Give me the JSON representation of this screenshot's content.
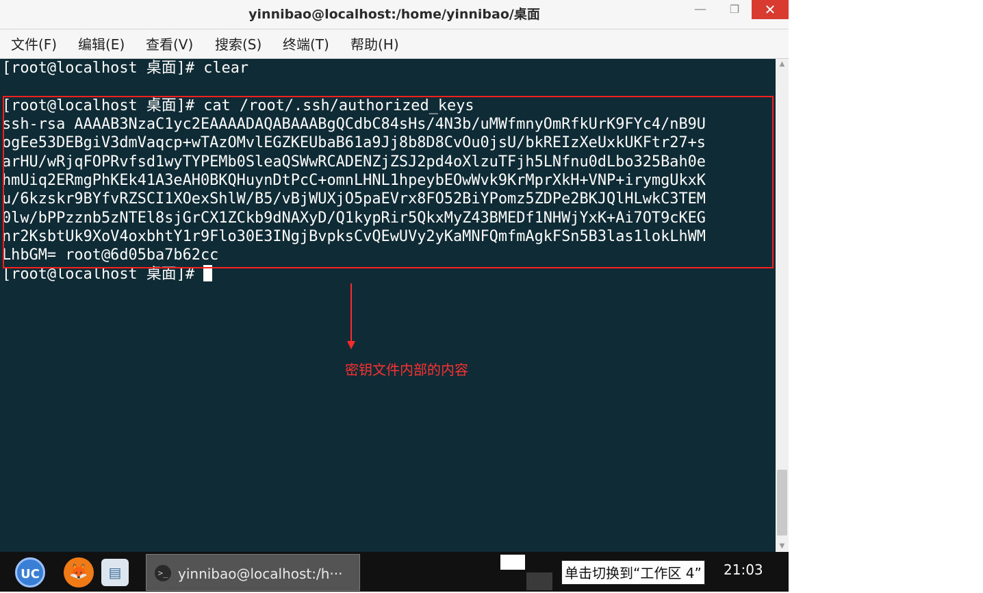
{
  "window": {
    "title": "yinnibao@localhost:/home/yinnibao/桌面",
    "min_glyph": "—",
    "max_glyph": "❐",
    "close_glyph": "✕"
  },
  "menu": [
    {
      "label": "文件(F)"
    },
    {
      "label": "编辑(E)"
    },
    {
      "label": "查看(V)"
    },
    {
      "label": "搜索(S)"
    },
    {
      "label": "终端(T)"
    },
    {
      "label": "帮助(H)"
    }
  ],
  "terminal": {
    "background": "#0f2b36",
    "lines": [
      "[root@localhost 桌面]# clear",
      "",
      "[root@localhost 桌面]# cat /root/.ssh/authorized_keys",
      "ssh-rsa AAAAB3NzaC1yc2EAAAADAQABAAABgQCdbC84sHs/4N3b/uMWfmnyOmRfkUrK9FYc4/nB9U",
      "ogEe53DEBgiV3dmVaqcp+wTAzOMvlEGZKEUbaB61a9Jj8b8D8CvOu0jsU/bkREIzXeUxkUKFtr27+s",
      "arHU/wRjqFOPRvfsd1wyTYPEMb0SleaQSWwRCADENZjZSJ2pd4oXlzuTFjh5LNfnu0dLbo325Bah0e",
      "hmUiq2ERmgPhKEk41A3eAH0BKQHuynDtPcC+omnLHNL1hpeybEOwWvk9KrMprXkH+VNP+irymgUkxK",
      "u/6kzskr9BYfvRZSCI1XOexShlW/B5/vBjWUXjO5paEVrx8FO52BiYPomz5ZDPe2BKJQlHLwkC3TEM",
      "0lw/bPPzznb5zNTEl8sjGrCX1ZCkb9dNAXyD/Q1kypRir5QkxMyZ43BMEDf1NHWjYxK+Ai7OT9cKEG",
      "nr2KsbtUk9XoV4oxbhtY1r9Flo30E3INgjBvpksCvQEwUVy2yKaMNFQmfmAgkFSn5B3las1lokLhWM",
      "LhbGM= root@6d05ba7b62cc",
      "[root@localhost 桌面]# "
    ]
  },
  "annotation": {
    "text": "密钥文件内部的内容",
    "color": "#ff2a2a"
  },
  "scrollbar": {
    "up_glyph": "▲",
    "down_glyph": "▼"
  },
  "taskbar": {
    "uc_label": "UC",
    "fox_glyph": "🦊",
    "files_glyph": "▤",
    "term_glyph": ">_",
    "task_label": "yinnibao@localhost:/h···",
    "workspace_tooltip": "单击切换到“工作区 4”",
    "clock": "21:03"
  }
}
